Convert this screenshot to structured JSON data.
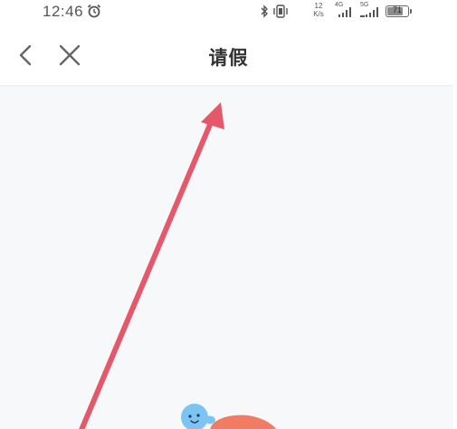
{
  "status_bar": {
    "time": "12:46",
    "network_speed_value": "12",
    "network_speed_unit": "K/s",
    "sim1_tag": "4G",
    "sim2_tag": "5G",
    "battery_level": "71",
    "icons": [
      "alarm-icon",
      "bluetooth-icon",
      "vibrate-icon",
      "signal-icon",
      "signal-icon",
      "battery-icon"
    ]
  },
  "nav": {
    "title": "请假",
    "back_icon": "chevron-left-icon",
    "close_icon": "close-icon"
  },
  "colors": {
    "arrow": "#e5586a",
    "content_bg": "#f7f8fa",
    "mascot_body": "#7cc4f2",
    "mascot_accent": "#f27b62"
  }
}
